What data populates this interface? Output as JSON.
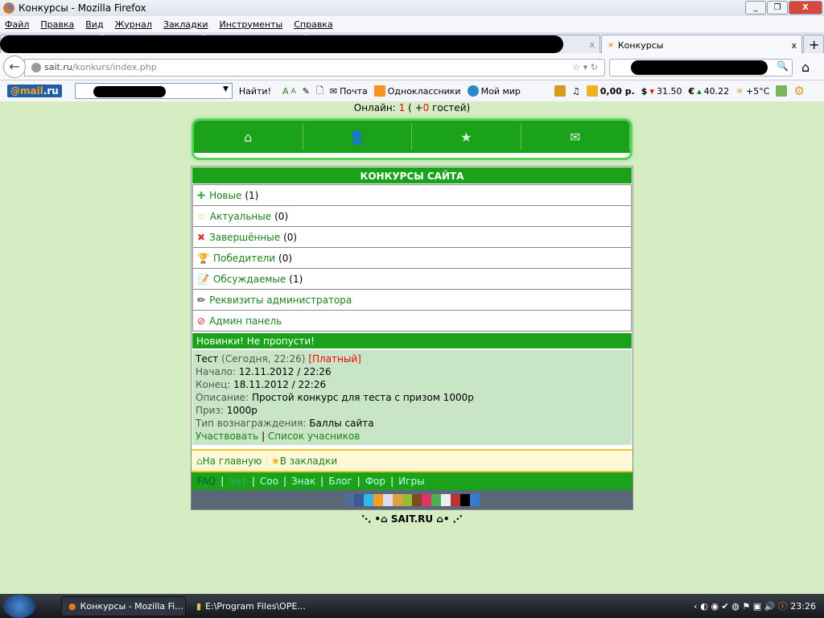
{
  "window": {
    "title": "Конкурсы - Mozilla Firefox"
  },
  "menu": [
    "Файл",
    "Правка",
    "Вид",
    "Журнал",
    "Закладки",
    "Инструменты",
    "Справка"
  ],
  "tabs": {
    "active": "Конкурсы"
  },
  "url": {
    "host": "sait.ru",
    "path": "/konkurs/index.php"
  },
  "mailbar": {
    "logo_a": "@mail",
    "logo_b": ".ru",
    "find": "Найти!",
    "mail": "Почта",
    "ok": "Одноклассники",
    "mir": "Мой мир",
    "balance": "0,00 р.",
    "usd": "31.50",
    "eur": "40.22",
    "weather": "+5°C"
  },
  "online": {
    "label": "Онлайн:",
    "count": "1",
    "open": "( +",
    "guests": "0",
    "close": "гостей)"
  },
  "panel": {
    "title": "КОНКУРСЫ САЙТА",
    "items": [
      {
        "label": "Новые",
        "count": "(1)"
      },
      {
        "label": "Актуальные",
        "count": "(0)"
      },
      {
        "label": "Завершённые",
        "count": "(0)"
      },
      {
        "label": "Победители",
        "count": "(0)"
      },
      {
        "label": "Обсуждаемые",
        "count": "(1)"
      },
      {
        "label": "Реквизиты администратора",
        "count": ""
      },
      {
        "label": "Админ панель",
        "count": ""
      }
    ]
  },
  "news": {
    "title": "Новинки! Не пропусти!",
    "name": "Тест",
    "when": "(Сегодня, 22:26)",
    "paid": "[Платный]",
    "start_label": "Начало:",
    "start": "12.11.2012 / 22:26",
    "end_label": "Конец:",
    "end": "18.11.2012 / 22:26",
    "desc_label": "Описание:",
    "desc": "Простой конкурс для теста с призом 1000р",
    "prize_label": "Приз:",
    "prize": "1000р",
    "type_label": "Тип вознаграждения:",
    "type": "Баллы сайта",
    "join": "Участвовать",
    "list": "Список учасников"
  },
  "footer": {
    "home": "На главную",
    "bookmarks": "В закладки",
    "links": [
      "FAQ",
      "Чат",
      "Соо",
      "Знак",
      "Блог",
      "Фор",
      "Игры"
    ],
    "brand": "SAIT.RU"
  },
  "taskbar": {
    "item1": "Конкурсы - Mozilla Fi...",
    "item2": "E:\\Program Files\\OPE...",
    "clock": "23:26"
  }
}
